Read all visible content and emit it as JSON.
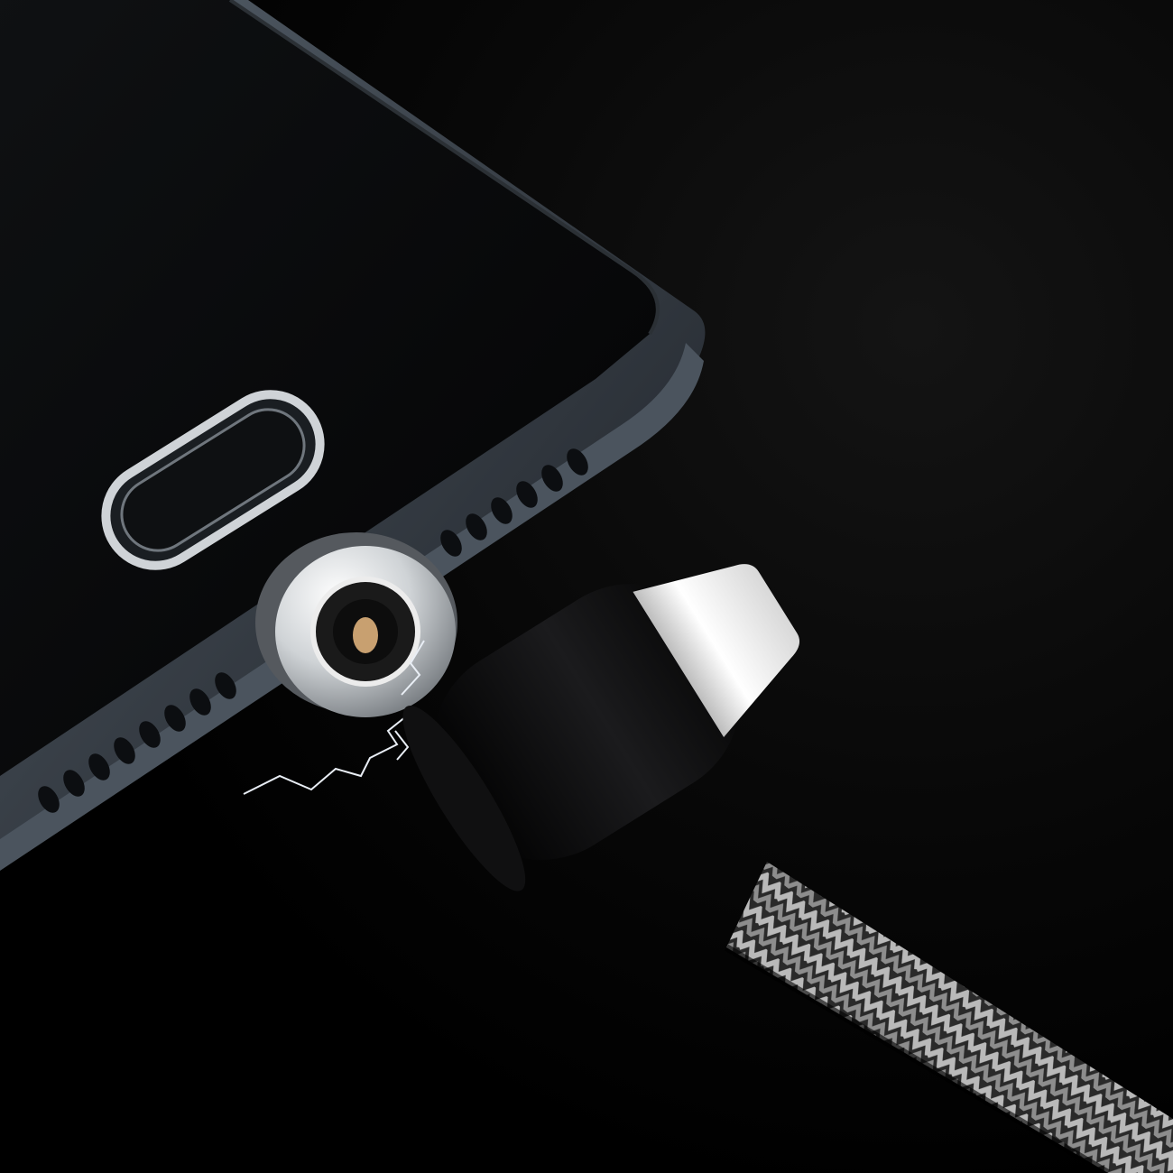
{
  "scene": {
    "background": "#050505",
    "phone": {
      "frame_color": "#3a4048",
      "frame_highlight": "#7c8590",
      "screen_color": "#060708",
      "home_button_ring": "#c9cdd2",
      "speaker_grille_color": "#0d0f12"
    },
    "magnetic_tip": {
      "metal_color": "#d9dcdf",
      "center_color": "#1a1a1a",
      "pin_color": "#c8a070"
    },
    "connector": {
      "body_color": "#0b0b0c",
      "collar_color": "#f2f2f2"
    },
    "cable": {
      "braid_dark": "#2a2a2a",
      "braid_light": "#b9b9b9"
    },
    "spark_color": "#e9eef5"
  }
}
